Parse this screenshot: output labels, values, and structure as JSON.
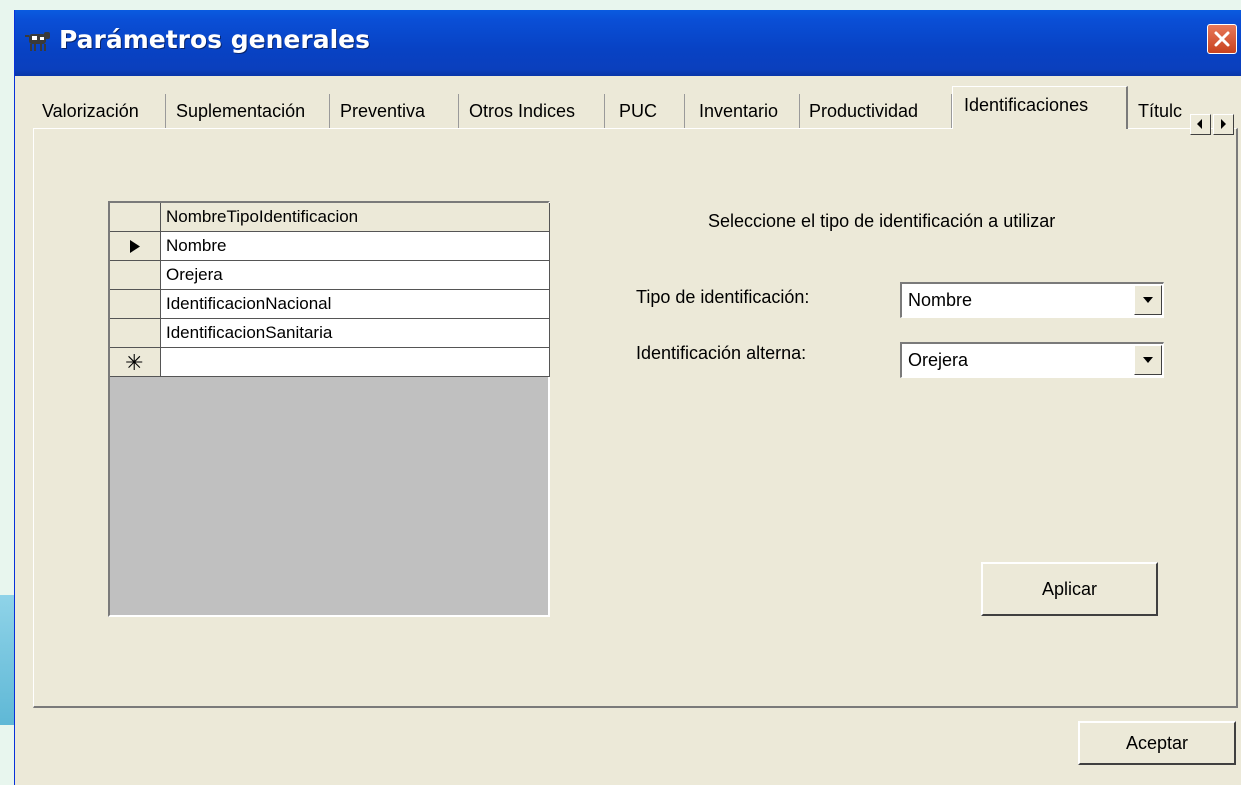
{
  "window": {
    "title": "Parámetros generales",
    "icons": {
      "app": "cow-icon",
      "close": "close-icon"
    }
  },
  "tabs": [
    {
      "label": "Valorización",
      "active": false
    },
    {
      "label": "Suplementación",
      "active": false
    },
    {
      "label": "Preventiva",
      "active": false
    },
    {
      "label": "Otros Indices",
      "active": false
    },
    {
      "label": "PUC",
      "active": false
    },
    {
      "label": "Inventario",
      "active": false
    },
    {
      "label": "Productividad",
      "active": false
    },
    {
      "label": "Identificaciones",
      "active": true
    },
    {
      "label": "Títulc",
      "active": false
    }
  ],
  "tab_scroll": {
    "left_icon": "scroll-left-icon",
    "right_icon": "scroll-right-icon"
  },
  "grid": {
    "header": "NombreTipoIdentificacion",
    "rows": [
      "Nombre",
      "Orejera",
      "IdentificacionNacional",
      "IdentificacionSanitaria"
    ],
    "current_row_icon": "row-pointer-icon",
    "new_row_marker": "✳"
  },
  "form": {
    "instruction": "Seleccione el tipo de identificación a utilizar",
    "tipo_label": "Tipo de identificación:",
    "tipo_value": "Nombre",
    "alterna_label": "Identificación alterna:",
    "alterna_value": "Orejera",
    "apply_label": "Aplicar"
  },
  "footer": {
    "accept_label": "Aceptar"
  }
}
